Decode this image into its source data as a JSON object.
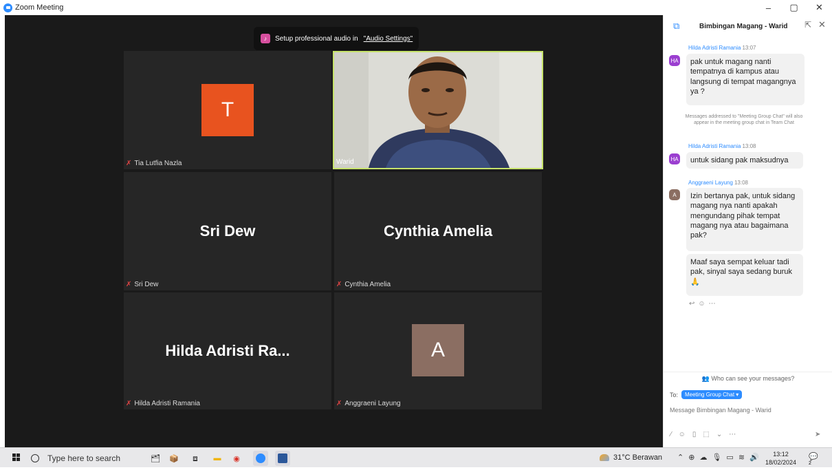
{
  "window": {
    "title": "Zoom Meeting",
    "controls": [
      "–",
      "▢",
      "✕"
    ]
  },
  "audio_banner": {
    "text": "Setup professional audio in",
    "link": "\"Audio Settings\""
  },
  "participants": [
    {
      "name": "Tia Lutfia Nazla",
      "initial": "T",
      "color": "#E8531F",
      "muted": true
    },
    {
      "name": "Warid",
      "video": true,
      "active_speaker": true
    },
    {
      "name": "Sri Dew",
      "big_label": "Sri Dew",
      "muted": true
    },
    {
      "name": "Cynthia Amelia",
      "big_label": "Cynthia Amelia",
      "muted": true
    },
    {
      "name": "Hilda Adristi Ramania",
      "big_label": "Hilda Adristi Ra...",
      "muted": true
    },
    {
      "name": "Anggraeni Layung",
      "initial": "A",
      "color": "#8B6E62",
      "muted": true
    }
  ],
  "chat": {
    "title": "Bimbingan Magang - Warid",
    "messages": [
      {
        "sender": "Hilda Adristi Ramania",
        "time": "13:07",
        "initials": "HA",
        "avatar_color": "#9B3FD0",
        "text": "pak untuk magang nanti tempatnya di kampus atau langsung di tempat magangnya ya ?"
      },
      {
        "sender": "Hilda Adristi Ramania",
        "time": "13:08",
        "initials": "HA",
        "avatar_color": "#9B3FD0",
        "text": "untuk sidang pak maksudnya"
      },
      {
        "sender": "Anggraeni Layung",
        "time": "13:08",
        "initials": "A",
        "avatar_color": "#8B6E62",
        "text": "Izin bertanya pak, untuk sidang magang nya nanti apakah mengundang pihak tempat magang nya atau bagaimana pak?"
      },
      {
        "text": "Maaf saya sempat keluar tadi pak, sinyal saya sedang buruk 🙏"
      }
    ],
    "notice": "Messages addressed to \"Meeting Group Chat\" will also appear in the meeting group chat in Team Chat",
    "who_can_see": "Who can see your messages?",
    "to_label": "To:",
    "recipient": "Meeting Group Chat",
    "input_placeholder": "Message Bimbingan Magang - Warid"
  },
  "taskbar": {
    "search_placeholder": "Type here to search",
    "weather": "31°C  Berawan",
    "time": "13:12",
    "date": "18/02/2024",
    "notification_count": "2"
  }
}
